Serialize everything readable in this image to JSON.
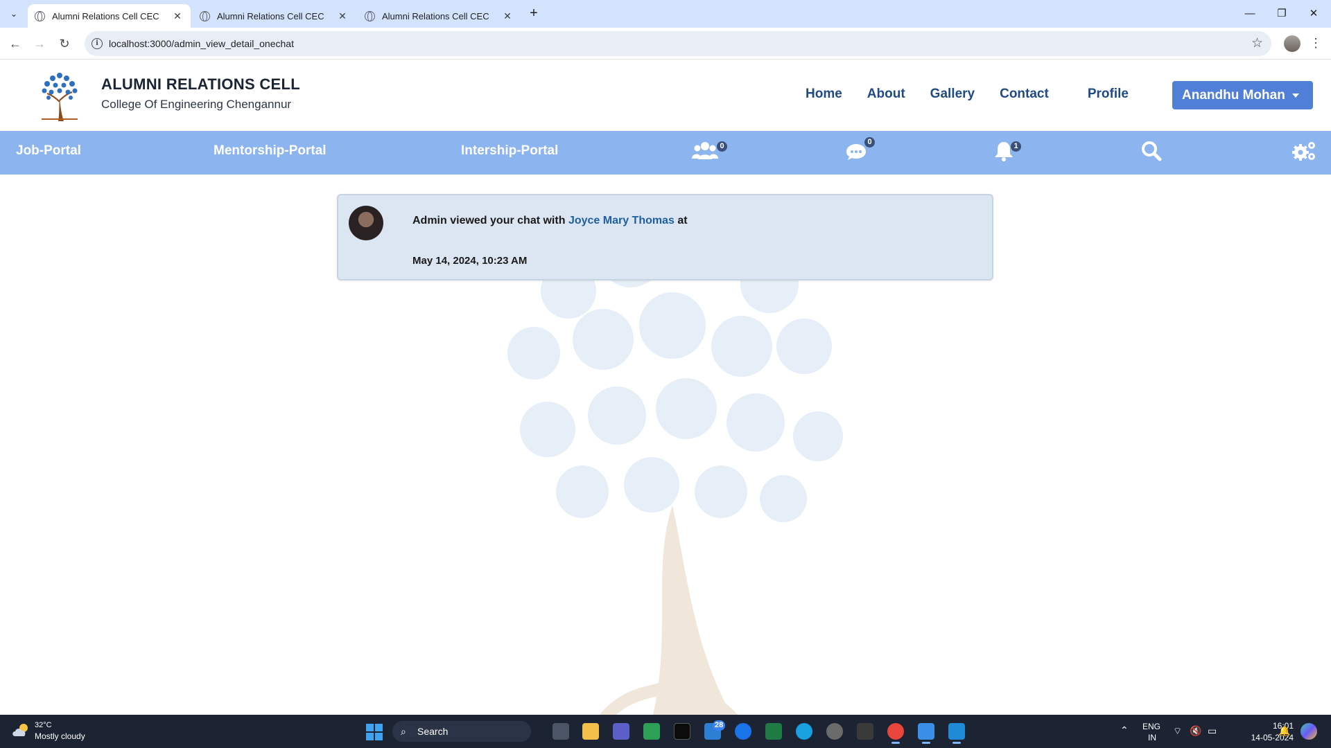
{
  "browser": {
    "tabs": [
      {
        "title": "Alumni Relations Cell CEC",
        "active": true
      },
      {
        "title": "Alumni Relations Cell CEC",
        "active": false
      },
      {
        "title": "Alumni Relations Cell CEC",
        "active": false
      }
    ],
    "url": "localhost:3000/admin_view_detail_onechat"
  },
  "header": {
    "title": "ALUMNI RELATIONS CELL",
    "subtitle": "College Of Engineering Chengannur",
    "nav": {
      "home": "Home",
      "about": "About",
      "gallery": "Gallery",
      "contact": "Contact",
      "profile": "Profile"
    },
    "user_name": "Anandhu Mohan"
  },
  "portal_bar": {
    "job": "Job-Portal",
    "mentorship": "Mentorship-Portal",
    "internship": "Intership-Portal",
    "group_count": "0",
    "chat_count": "0",
    "notification_count": "1"
  },
  "notice": {
    "prefix": "Admin viewed your chat with",
    "person": "Joyce Mary Thomas",
    "suffix": "at",
    "timestamp": "May 14, 2024, 10:23 AM"
  },
  "taskbar": {
    "temperature": "32°C",
    "weather": "Mostly cloudy",
    "search_label": "Search",
    "mail_badge": "28",
    "lang_top": "ENG",
    "lang_bottom": "IN",
    "time": "16:01",
    "date": "14-05-2024"
  },
  "colors": {
    "portal_bar": "#8cb4ef",
    "nav_link": "#204a86",
    "user_button": "#4f7fd6",
    "card_bg": "#dbe6f2"
  }
}
